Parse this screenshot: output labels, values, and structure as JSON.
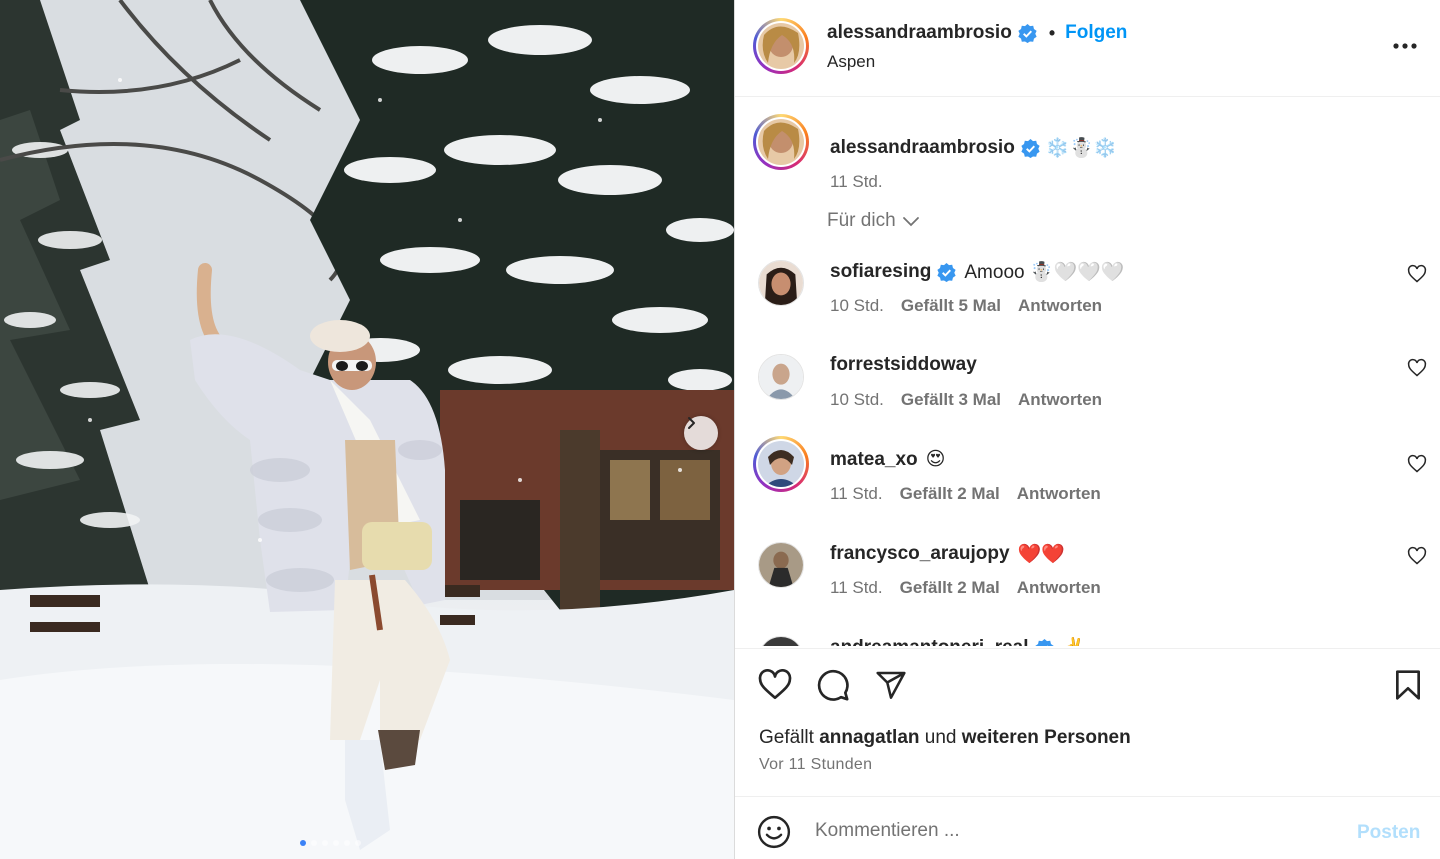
{
  "post": {
    "username": "alessandraambrosio",
    "follow_label": "Folgen",
    "separator": "•",
    "location": "Aspen",
    "more_icon": "more-horizontal-icon"
  },
  "caption": {
    "username": "alessandraambrosio",
    "text": "❄️☃️❄️",
    "time": "11 Std."
  },
  "filter": {
    "label": "Für dich"
  },
  "comments": [
    {
      "username": "sofiaresing",
      "verified": true,
      "text": "Amooo ☃️🤍🤍🤍",
      "time": "10 Std.",
      "likes": "Gefällt 5 Mal",
      "reply": "Antworten"
    },
    {
      "username": "forrestsiddoway",
      "verified": false,
      "text": "",
      "time": "10 Std.",
      "likes": "Gefällt 3 Mal",
      "reply": "Antworten"
    },
    {
      "username": "matea_xo",
      "verified": false,
      "text": "😍",
      "time": "11 Std.",
      "likes": "Gefällt 2 Mal",
      "reply": "Antworten"
    },
    {
      "username": "francysco_araujopy",
      "verified": false,
      "text": "❤️❤️",
      "time": "11 Std.",
      "likes": "Gefällt 2 Mal",
      "reply": "Antworten"
    },
    {
      "username": "andreamantoneri_real",
      "verified": true,
      "text": "✌️",
      "time": "",
      "likes": "",
      "reply": ""
    }
  ],
  "actions": {
    "likes_prefix": "Gefällt",
    "likes_user": "annagatlan",
    "likes_middle": "und",
    "likes_rest": "weiteren Personen",
    "time_ago": "Vor 11 Stunden"
  },
  "composer": {
    "placeholder": "Kommentieren ...",
    "post_label": "Posten"
  },
  "carousel": {
    "slide_count": 6,
    "active_index": 0
  },
  "colors": {
    "accent": "#0095f6",
    "verified": "#3897f0",
    "muted": "#737373",
    "post_disabled": "#b2dffc"
  }
}
